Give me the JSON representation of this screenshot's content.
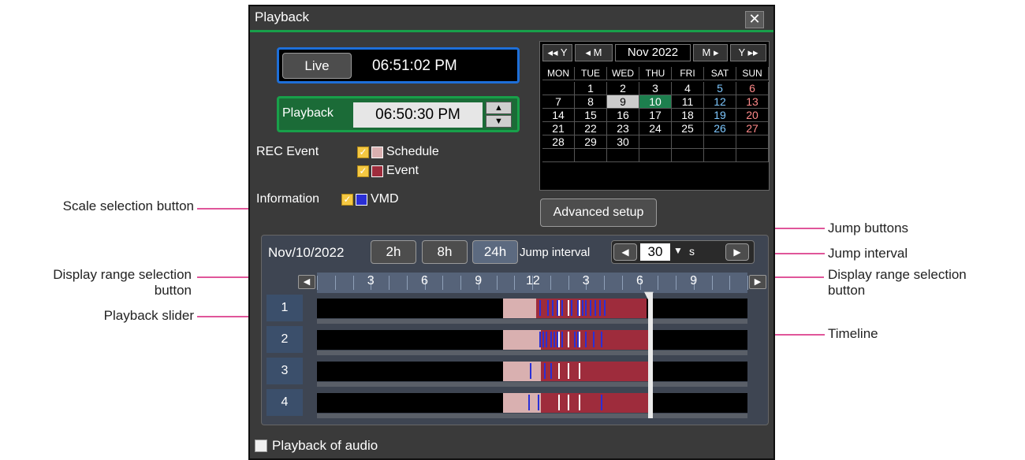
{
  "annotations": {
    "scale_selection": "Scale selection button",
    "display_range_left_line1": "Display range selection",
    "display_range_left_line2": "button",
    "playback_slider": "Playback slider",
    "jump_buttons": "Jump buttons",
    "jump_interval": "Jump interval",
    "display_range_right_line1": "Display range selection",
    "display_range_right_line2": "button",
    "timeline": "Timeline"
  },
  "window": {
    "title": "Playback",
    "close_glyph": "✕"
  },
  "live": {
    "label": "Live",
    "time": "06:51:02 PM"
  },
  "playback": {
    "label": "Playback",
    "time": "06:50:30 PM"
  },
  "rec_event": {
    "label": "REC Event",
    "schedule": "Schedule",
    "event": "Event"
  },
  "information": {
    "label": "Information",
    "vmd": "VMD"
  },
  "advanced_setup": "Advanced setup",
  "calendar": {
    "nav_prev_year": "◂◂ Y",
    "nav_prev_month": "◂ M",
    "month": "Nov 2022",
    "nav_next_month": "M ▸",
    "nav_next_year": "Y ▸▸",
    "weekdays": [
      "MON",
      "TUE",
      "WED",
      "THU",
      "FRI",
      "SAT",
      "SUN"
    ],
    "weeks": [
      [
        "",
        "1",
        "2",
        "3",
        "4",
        "5",
        "6"
      ],
      [
        "7",
        "8",
        "9",
        "10",
        "11",
        "12",
        "13"
      ],
      [
        "14",
        "15",
        "16",
        "17",
        "18",
        "19",
        "20"
      ],
      [
        "21",
        "22",
        "23",
        "24",
        "25",
        "26",
        "27"
      ],
      [
        "28",
        "29",
        "30",
        "",
        "",
        "",
        ""
      ],
      [
        "",
        "",
        "",
        "",
        "",
        "",
        ""
      ]
    ],
    "selected_day": "9",
    "today": "10"
  },
  "timeline_bar": {
    "date": "Nov/10/2022",
    "scale_buttons": [
      "2h",
      "8h",
      "24h"
    ],
    "jump_interval_label": "Jump interval",
    "jump_value": "30",
    "jump_unit": "s",
    "hour_labels": [
      "3",
      "6",
      "9",
      "12",
      "3",
      "6",
      "9"
    ]
  },
  "cameras": [
    "1",
    "2",
    "3",
    "4"
  ],
  "audio_label": "Playback of audio",
  "colors": {
    "schedule": "#d9b0b0",
    "event": "#9e2c3c",
    "vmd": "#2a2fd6",
    "accent_green": "#18a04a",
    "live_border": "#1e6fd8"
  }
}
